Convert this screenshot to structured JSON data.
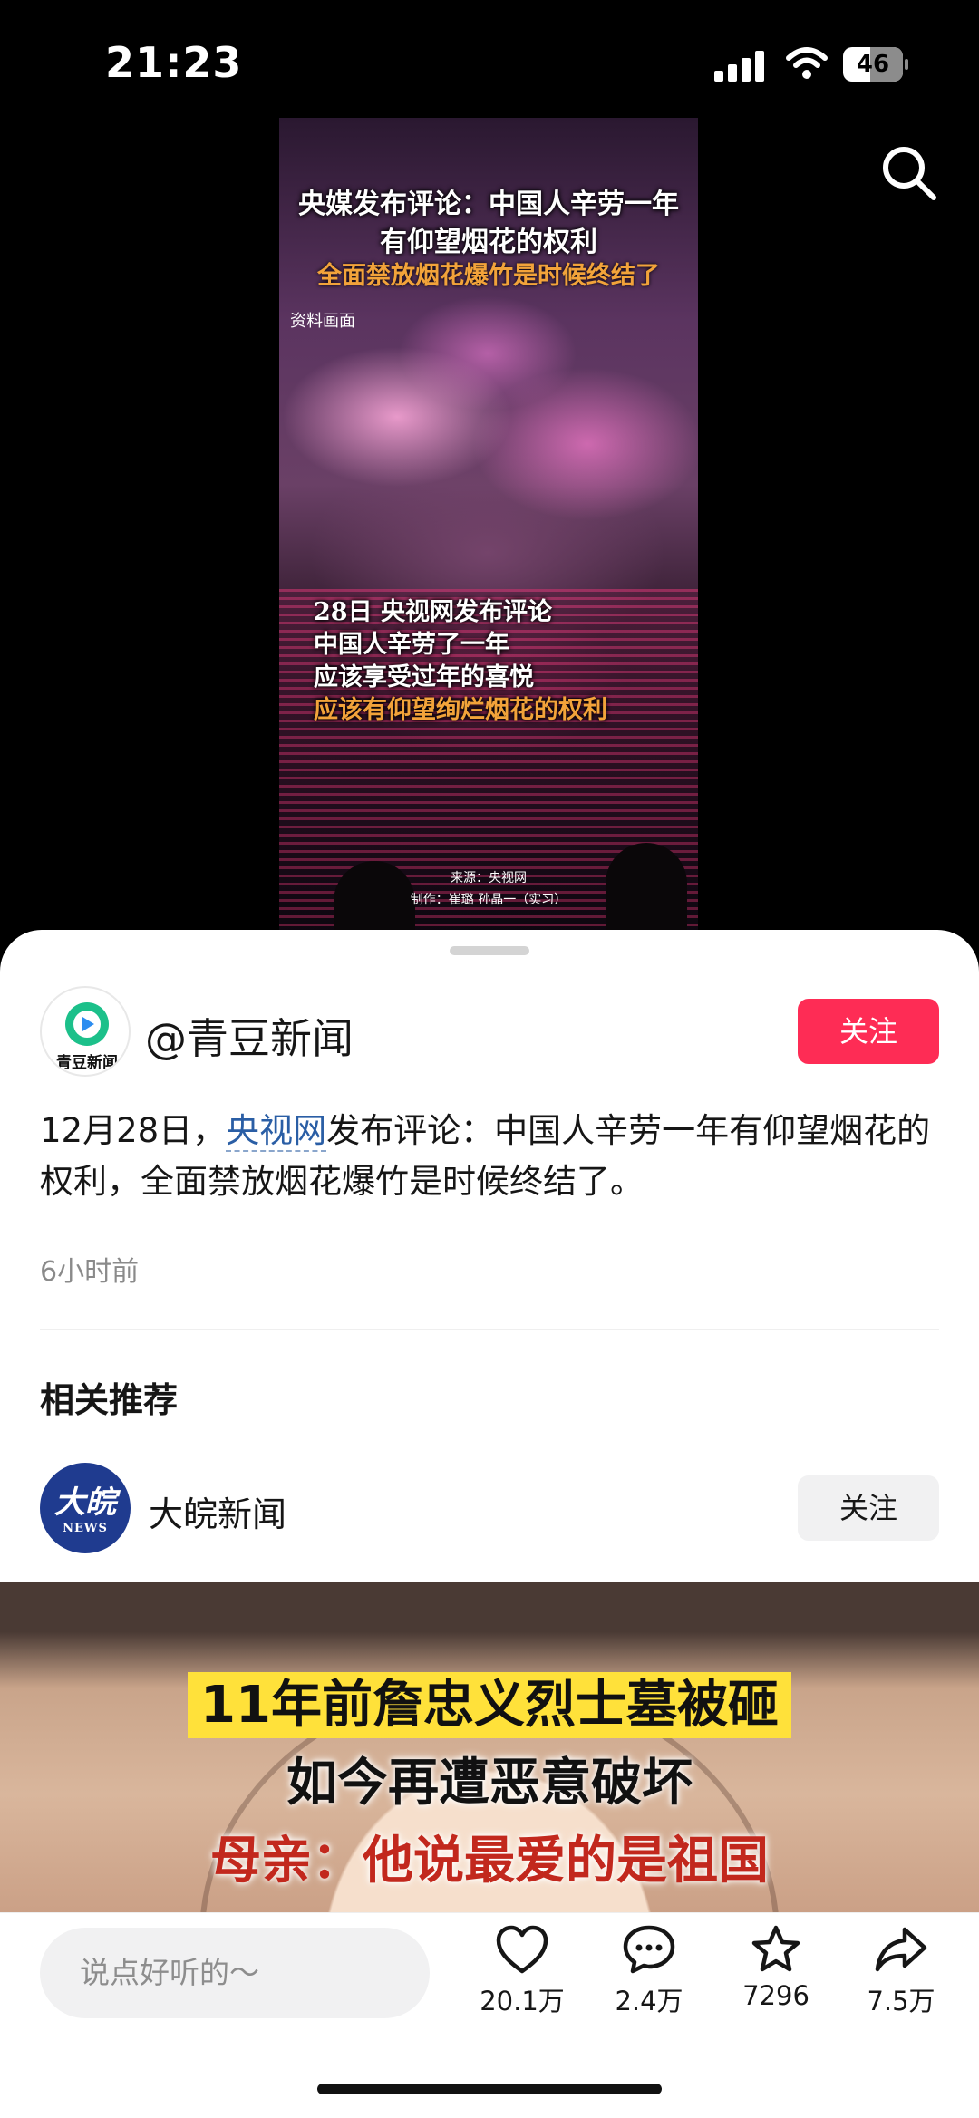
{
  "status_bar": {
    "time": "21:23",
    "battery": "46",
    "battery_level": 0.46
  },
  "video": {
    "headline_1": "央媒发布评论：中国人辛劳一年",
    "headline_2": "有仰望烟花的权利",
    "headline_3": "全面禁放烟花爆竹是时候终结了",
    "source_note": "资料画面",
    "lines": [
      "28日 央视网发布评论",
      "中国人辛劳了一年",
      "应该享受过年的喜悦",
      "应该有仰望绚烂烟花的权利"
    ],
    "credit_source": "来源：央视网",
    "credit_maker": "制作：崔璐 孙晶一（实习）"
  },
  "post": {
    "author": "@青豆新闻",
    "avatar_text": "青豆新闻",
    "follow": "关注",
    "desc_before": "12月28日，",
    "desc_link": "央视网",
    "desc_after": "发布评论：中国人辛劳一年有仰望烟花的权利，全面禁放烟花爆竹是时候终结了。",
    "time_ago": "6小时前"
  },
  "related": {
    "title": "相关推荐",
    "account": "大皖新闻",
    "avatar_big": "大皖",
    "avatar_small": "NEWS",
    "follow": "关注",
    "thumb_lines": [
      "11年前詹忠义烈士墓被砸",
      "如今再遭恶意破坏",
      "母亲：他说最爱的是祖国"
    ]
  },
  "action_bar": {
    "comment_placeholder": "说点好听的～",
    "likes": "20.1万",
    "comments": "2.4万",
    "favorites": "7296",
    "shares": "7.5万"
  },
  "colors": {
    "follow_red": "#fe2c55",
    "link_blue": "#2a5ea5",
    "highlight_yellow": "#ffe13a",
    "thumb_red": "#c2281d"
  },
  "icons": [
    "search-icon",
    "signal-icon",
    "wifi-icon",
    "battery-icon",
    "heart-icon",
    "comment-icon",
    "star-icon",
    "share-icon"
  ]
}
